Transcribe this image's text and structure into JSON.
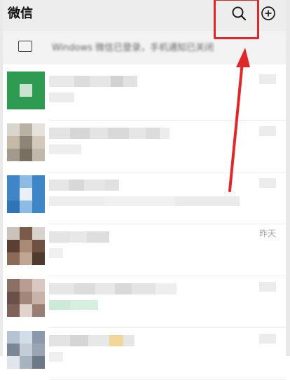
{
  "header": {
    "title": "微信",
    "search_icon": "search-icon",
    "add_icon": "add-circle-icon"
  },
  "banner": {
    "icon": "monitor-icon",
    "text": "Windows 微信已登录，手机通知已关闭"
  },
  "chats": [
    {
      "time": "",
      "avatar_colors": [
        "#2f9b52",
        "#2f9b52",
        "#2f9b52",
        "#2f9b52",
        "#c8e4d0",
        "#2f9b52",
        "#2f9b52",
        "#2f9b52",
        "#2f9b52"
      ]
    },
    {
      "time": "",
      "avatar_colors": [
        "#d9d6d0",
        "#b8b1a4",
        "#e5e2dc",
        "#c6b9a6",
        "#8f8576",
        "#d2c9ba",
        "#a29a8c",
        "#7a7061",
        "#c0b8aa"
      ]
    },
    {
      "time": "",
      "avatar_colors": [
        "#3f86c9",
        "#8cbbe6",
        "#3f86c9",
        "#3f86c9",
        "#e8f1fb",
        "#3f86c9",
        "#2f74b5",
        "#8cbbe6",
        "#3f86c9"
      ]
    },
    {
      "time": "昨天",
      "avatar_colors": [
        "#c9c3bc",
        "#7a5a48",
        "#d8d2cc",
        "#5a3f32",
        "#a98a74",
        "#6e5141",
        "#8b6b58",
        "#c0a693",
        "#4e3a2f"
      ]
    },
    {
      "time": "",
      "avatar_colors": [
        "#8e6f66",
        "#b99c92",
        "#d9c8c2",
        "#6b5049",
        "#a4857b",
        "#c8b3ab",
        "#7f635b",
        "#e0d2cc",
        "#9a7d73"
      ]
    },
    {
      "time": "",
      "avatar_colors": [
        "#b6c3d3",
        "#d3dde8",
        "#8c99aa",
        "#7b8696",
        "#c4ccd6",
        "#9aa5b4",
        "#e0e6ec",
        "#a8b3c0",
        "#6e7988"
      ]
    }
  ],
  "colors": {
    "annotation": "#e0282a",
    "header_bg": "#ededed",
    "banner_bg": "#f3f3f3"
  }
}
